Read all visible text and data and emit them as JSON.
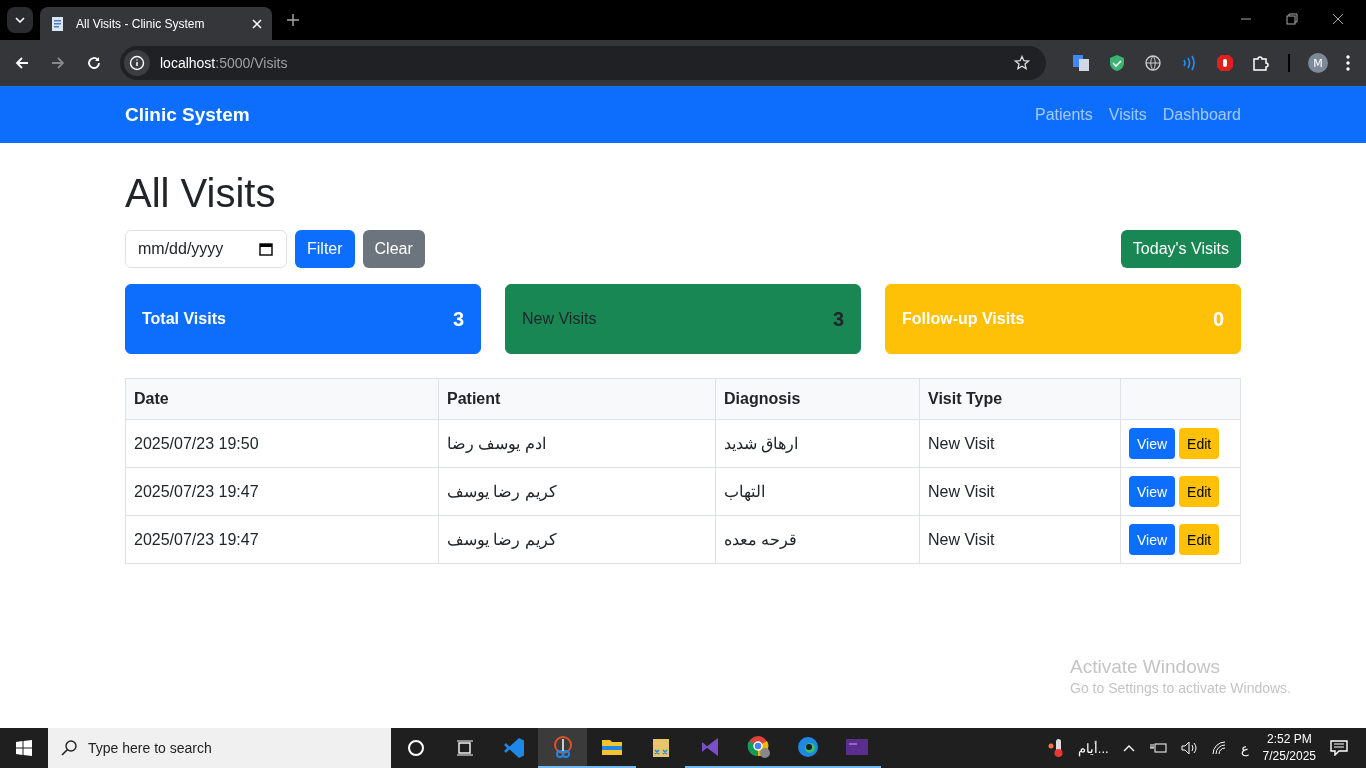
{
  "browser": {
    "tab_title": "All Visits - Clinic System",
    "url_host": "localhost",
    "url_path": ":5000/Visits",
    "profile_initial": "M"
  },
  "navbar": {
    "brand": "Clinic System",
    "links": [
      "Patients",
      "Visits",
      "Dashboard"
    ]
  },
  "page": {
    "title": "All Visits",
    "date_placeholder": "mm/dd/yyyy",
    "filter_button": "Filter",
    "clear_button": "Clear",
    "today_button": "Today's Visits"
  },
  "stats": [
    {
      "label": "Total Visits",
      "value": "3",
      "color": "#0d6efd",
      "kind": "light"
    },
    {
      "label": "New Visits",
      "value": "3",
      "color": "#198754",
      "kind": "dark"
    },
    {
      "label": "Follow-up Visits",
      "value": "0",
      "color": "#ffc107",
      "kind": "light"
    }
  ],
  "table": {
    "columns": [
      "Date",
      "Patient",
      "Diagnosis",
      "Visit Type"
    ],
    "rows": [
      {
        "date": "2025/07/23 19:50",
        "patient": "ادم يوسف رضا",
        "diagnosis": "ارهاق شديد",
        "visit_type": "New Visit",
        "actions": [
          "View",
          "Edit"
        ]
      },
      {
        "date": "2025/07/23 19:47",
        "patient": "كريم رضا يوسف",
        "diagnosis": "التهاب",
        "visit_type": "New Visit",
        "actions": [
          "View",
          "Edit"
        ]
      },
      {
        "date": "2025/07/23 19:47",
        "patient": "كريم رضا يوسف",
        "diagnosis": "قرحه معده",
        "visit_type": "New Visit",
        "actions": [
          "View",
          "Edit"
        ]
      }
    ]
  },
  "activation": {
    "title": "Activate Windows",
    "subtitle": "Go to Settings to activate Windows."
  },
  "taskbar": {
    "search_placeholder": "Type here to search",
    "weather": "أيام...",
    "language": "ع",
    "time": "2:52 PM",
    "date": "7/25/2025"
  }
}
